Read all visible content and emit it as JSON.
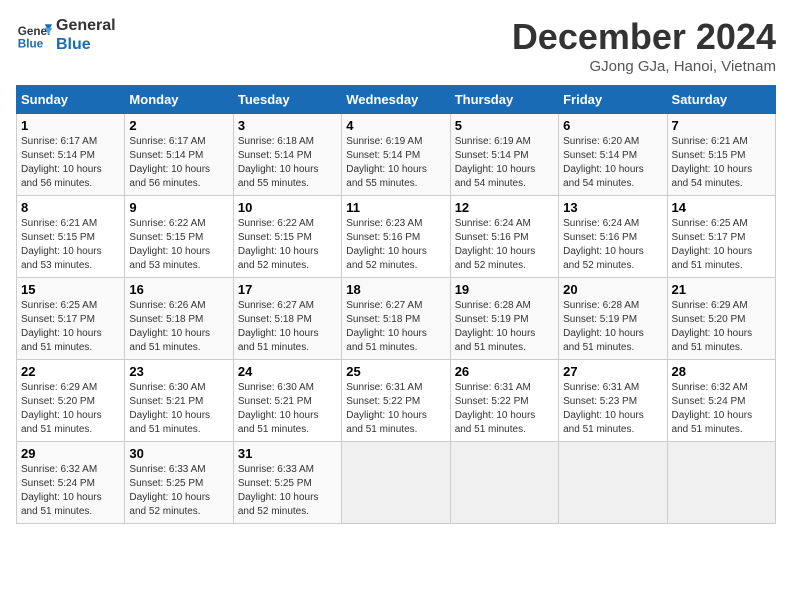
{
  "header": {
    "logo_line1": "General",
    "logo_line2": "Blue",
    "title": "December 2024",
    "subtitle": "GJong GJa, Hanoi, Vietnam"
  },
  "calendar": {
    "days_of_week": [
      "Sunday",
      "Monday",
      "Tuesday",
      "Wednesday",
      "Thursday",
      "Friday",
      "Saturday"
    ],
    "weeks": [
      [
        {
          "day": "",
          "info": ""
        },
        {
          "day": "2",
          "info": "Sunrise: 6:17 AM\nSunset: 5:14 PM\nDaylight: 10 hours\nand 56 minutes."
        },
        {
          "day": "3",
          "info": "Sunrise: 6:18 AM\nSunset: 5:14 PM\nDaylight: 10 hours\nand 55 minutes."
        },
        {
          "day": "4",
          "info": "Sunrise: 6:19 AM\nSunset: 5:14 PM\nDaylight: 10 hours\nand 55 minutes."
        },
        {
          "day": "5",
          "info": "Sunrise: 6:19 AM\nSunset: 5:14 PM\nDaylight: 10 hours\nand 54 minutes."
        },
        {
          "day": "6",
          "info": "Sunrise: 6:20 AM\nSunset: 5:14 PM\nDaylight: 10 hours\nand 54 minutes."
        },
        {
          "day": "7",
          "info": "Sunrise: 6:21 AM\nSunset: 5:15 PM\nDaylight: 10 hours\nand 54 minutes."
        }
      ],
      [
        {
          "day": "8",
          "info": "Sunrise: 6:21 AM\nSunset: 5:15 PM\nDaylight: 10 hours\nand 53 minutes."
        },
        {
          "day": "9",
          "info": "Sunrise: 6:22 AM\nSunset: 5:15 PM\nDaylight: 10 hours\nand 53 minutes."
        },
        {
          "day": "10",
          "info": "Sunrise: 6:22 AM\nSunset: 5:15 PM\nDaylight: 10 hours\nand 52 minutes."
        },
        {
          "day": "11",
          "info": "Sunrise: 6:23 AM\nSunset: 5:16 PM\nDaylight: 10 hours\nand 52 minutes."
        },
        {
          "day": "12",
          "info": "Sunrise: 6:24 AM\nSunset: 5:16 PM\nDaylight: 10 hours\nand 52 minutes."
        },
        {
          "day": "13",
          "info": "Sunrise: 6:24 AM\nSunset: 5:16 PM\nDaylight: 10 hours\nand 52 minutes."
        },
        {
          "day": "14",
          "info": "Sunrise: 6:25 AM\nSunset: 5:17 PM\nDaylight: 10 hours\nand 51 minutes."
        }
      ],
      [
        {
          "day": "15",
          "info": "Sunrise: 6:25 AM\nSunset: 5:17 PM\nDaylight: 10 hours\nand 51 minutes."
        },
        {
          "day": "16",
          "info": "Sunrise: 6:26 AM\nSunset: 5:18 PM\nDaylight: 10 hours\nand 51 minutes."
        },
        {
          "day": "17",
          "info": "Sunrise: 6:27 AM\nSunset: 5:18 PM\nDaylight: 10 hours\nand 51 minutes."
        },
        {
          "day": "18",
          "info": "Sunrise: 6:27 AM\nSunset: 5:18 PM\nDaylight: 10 hours\nand 51 minutes."
        },
        {
          "day": "19",
          "info": "Sunrise: 6:28 AM\nSunset: 5:19 PM\nDaylight: 10 hours\nand 51 minutes."
        },
        {
          "day": "20",
          "info": "Sunrise: 6:28 AM\nSunset: 5:19 PM\nDaylight: 10 hours\nand 51 minutes."
        },
        {
          "day": "21",
          "info": "Sunrise: 6:29 AM\nSunset: 5:20 PM\nDaylight: 10 hours\nand 51 minutes."
        }
      ],
      [
        {
          "day": "22",
          "info": "Sunrise: 6:29 AM\nSunset: 5:20 PM\nDaylight: 10 hours\nand 51 minutes."
        },
        {
          "day": "23",
          "info": "Sunrise: 6:30 AM\nSunset: 5:21 PM\nDaylight: 10 hours\nand 51 minutes."
        },
        {
          "day": "24",
          "info": "Sunrise: 6:30 AM\nSunset: 5:21 PM\nDaylight: 10 hours\nand 51 minutes."
        },
        {
          "day": "25",
          "info": "Sunrise: 6:31 AM\nSunset: 5:22 PM\nDaylight: 10 hours\nand 51 minutes."
        },
        {
          "day": "26",
          "info": "Sunrise: 6:31 AM\nSunset: 5:22 PM\nDaylight: 10 hours\nand 51 minutes."
        },
        {
          "day": "27",
          "info": "Sunrise: 6:31 AM\nSunset: 5:23 PM\nDaylight: 10 hours\nand 51 minutes."
        },
        {
          "day": "28",
          "info": "Sunrise: 6:32 AM\nSunset: 5:24 PM\nDaylight: 10 hours\nand 51 minutes."
        }
      ],
      [
        {
          "day": "29",
          "info": "Sunrise: 6:32 AM\nSunset: 5:24 PM\nDaylight: 10 hours\nand 51 minutes."
        },
        {
          "day": "30",
          "info": "Sunrise: 6:33 AM\nSunset: 5:25 PM\nDaylight: 10 hours\nand 52 minutes."
        },
        {
          "day": "31",
          "info": "Sunrise: 6:33 AM\nSunset: 5:25 PM\nDaylight: 10 hours\nand 52 minutes."
        },
        {
          "day": "",
          "info": ""
        },
        {
          "day": "",
          "info": ""
        },
        {
          "day": "",
          "info": ""
        },
        {
          "day": "",
          "info": ""
        }
      ]
    ],
    "week1_day1": {
      "day": "1",
      "info": "Sunrise: 6:17 AM\nSunset: 5:14 PM\nDaylight: 10 hours\nand 56 minutes."
    }
  }
}
